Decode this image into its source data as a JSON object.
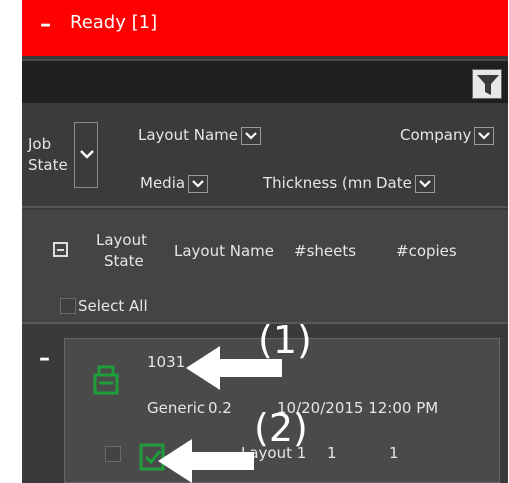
{
  "ready": {
    "collapse_symbol": "–",
    "title": "Ready [1]"
  },
  "toolbar": {
    "filter_icon": "funnel-icon"
  },
  "columns": {
    "job_state_line1": "Job",
    "job_state_line2": "State",
    "layout_name": "Layout Name",
    "company": "Company",
    "media": "Media",
    "thickness": "Thickness (mn",
    "date": "Date"
  },
  "layout_header": {
    "state_line1": "Layout",
    "state_line2": "State",
    "name": "Layout Name",
    "sheets": "#sheets",
    "copies": "#copies",
    "select_all": "Select All"
  },
  "job": {
    "collapse_symbol": "–",
    "name": "1031",
    "media": "Generic",
    "thickness": "0.2",
    "date": "10/20/2015 12:00 PM",
    "layout": {
      "name": "Layout 1",
      "sheets": "1",
      "copies": "1"
    }
  },
  "annotations": {
    "first": "(1)",
    "second": "(2)"
  },
  "colors": {
    "ready_bar": "#ff0000",
    "panel": "#3a3a3a",
    "icon_green": "#1e9e3a"
  }
}
